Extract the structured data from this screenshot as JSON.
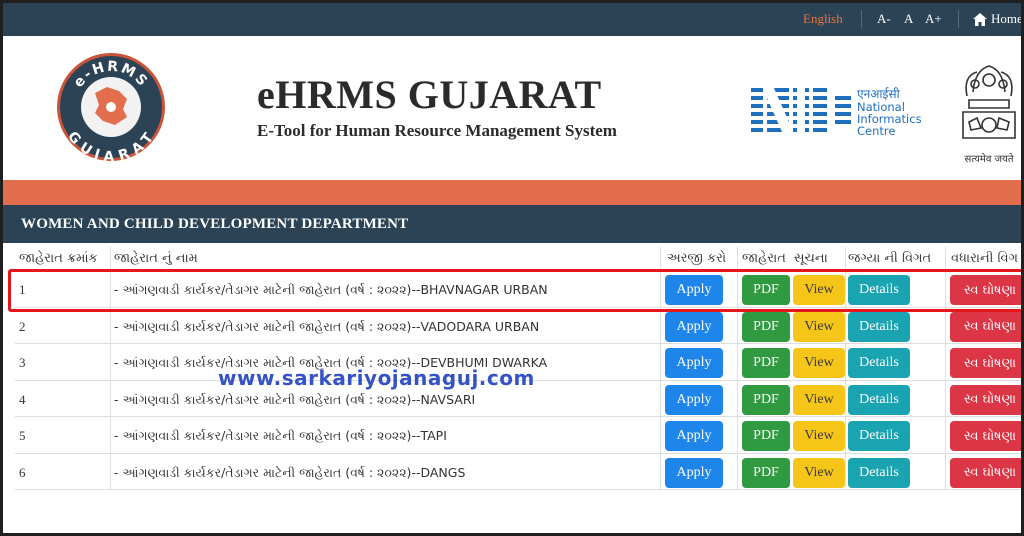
{
  "topbar": {
    "language": "English",
    "font_decrease": "A-",
    "font_normal": "A",
    "font_increase": "A+",
    "home": "Home"
  },
  "header": {
    "title": "eHRMS GUJARAT",
    "subtitle": "E-Tool for Human Resource Management System",
    "logo_top": "e-HRMS",
    "logo_bottom": "GUJARAT",
    "nic_hindi": "एनआईसी",
    "nic_line1": "National",
    "nic_line2": "Informatics",
    "nic_line3": "Centre",
    "emblem_motto": "सत्यमेव जयते"
  },
  "department": "WOMEN AND CHILD DEVELOPMENT DEPARTMENT",
  "table": {
    "headers": {
      "serial": "જાહેરાત ક્રમાંક",
      "name": "જાહેરાત નું નામ",
      "apply": "અરજી કરો",
      "advert": "જાહેરાત",
      "notice": "સૂચના",
      "vacancy": "જગ્યા ની વિગત",
      "extra": "વધારાની વિગ"
    },
    "buttons": {
      "apply": "Apply",
      "pdf": "PDF",
      "view": "View",
      "details": "Details",
      "self": "સ્વ ઘોષણા"
    },
    "rows": [
      {
        "sr": "1",
        "name": "- આંગણવાડી કાર્યકર/તેડાગર માટેની જાહેરાત (વર્ષ : ૨૦૨૨)--BHAVNAGAR URBAN"
      },
      {
        "sr": "2",
        "name": "- આંગણવાડી કાર્યકર/તેડાગર માટેની જાહેરાત (વર્ષ : ૨૦૨૨)--VADODARA URBAN"
      },
      {
        "sr": "3",
        "name": "- આંગણવાડી કાર્યકર/તેડાગર માટેની જાહેરાત (વર્ષ : ૨૦૨૨)--DEVBHUMI DWARKA"
      },
      {
        "sr": "4",
        "name": "- આંગણવાડી કાર્યકર/તેડાગર માટેની જાહેરાત (વર્ષ : ૨૦૨૨)--NAVSARI"
      },
      {
        "sr": "5",
        "name": "- આંગણવાડી કાર્યકર/તેડાગર માટેની જાહેરાત (વર્ષ : ૨૦૨૨)--TAPI"
      },
      {
        "sr": "6",
        "name": "- આંગણવાડી કાર્યકર/તેડાગર માટેની જાહેરાત (વર્ષ : ૨૦૨૨)--DANGS"
      }
    ]
  },
  "watermark": "www.sarkariyojanaguj.com",
  "colors": {
    "navy": "#2b4355",
    "orange": "#e26e4e",
    "apply": "#1e86ea",
    "pdf": "#2f9a3f",
    "view": "#f5c518",
    "details": "#1aa3b0",
    "self": "#dc3545",
    "highlight": "#e5171d"
  },
  "icons": [
    "home-icon"
  ]
}
